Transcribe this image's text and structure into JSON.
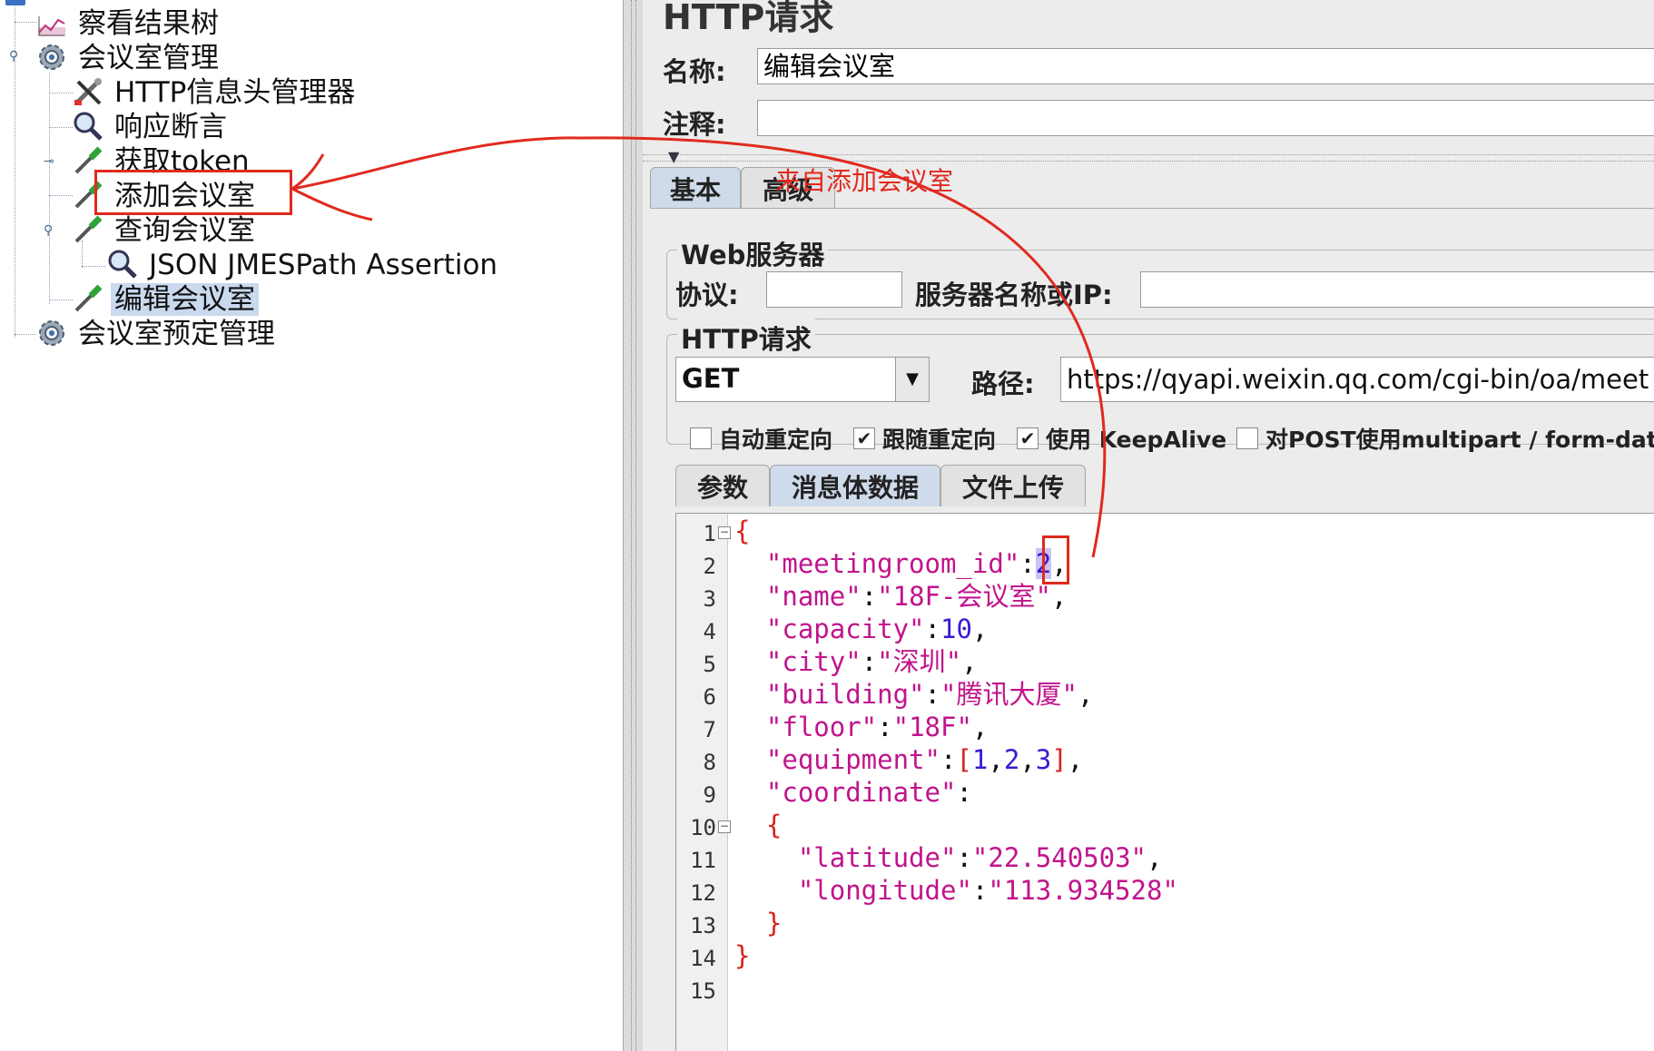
{
  "tree": {
    "items": [
      {
        "label": "察看结果树",
        "icon": "result-tree-icon"
      },
      {
        "label": "会议室管理",
        "icon": "gear-icon"
      },
      {
        "label": "HTTP信息头管理器",
        "icon": "wrench-icon"
      },
      {
        "label": "响应断言",
        "icon": "magnifier-icon"
      },
      {
        "label": "获取token",
        "icon": "pipette-icon"
      },
      {
        "label": "添加会议室",
        "icon": "pipette-icon"
      },
      {
        "label": "查询会议室",
        "icon": "pipette-icon"
      },
      {
        "label": "JSON JMESPath Assertion",
        "icon": "magnifier-icon"
      },
      {
        "label": "编辑会议室",
        "icon": "pipette-icon"
      },
      {
        "label": "会议室预定管理",
        "icon": "gear-icon"
      }
    ],
    "selected": "编辑会议室"
  },
  "panel": {
    "title": "HTTP请求",
    "name_label": "名称:",
    "name_value": "编辑会议室",
    "comment_label": "注释:",
    "comment_value": ""
  },
  "tabs": {
    "basic": "基本",
    "advanced": "高级"
  },
  "annotation": {
    "text": "来自添加会议室",
    "color": "#e02a1f"
  },
  "web_server": {
    "group_title": "Web服务器",
    "protocol_label": "协议:",
    "protocol_value": "",
    "server_label": "服务器名称或IP:",
    "server_value": ""
  },
  "http_request": {
    "group_title": "HTTP请求",
    "method": "GET",
    "path_label": "路径:",
    "path_value": "https://qyapi.weixin.qq.com/cgi-bin/oa/meet"
  },
  "options": [
    {
      "label": "自动重定向",
      "checked": false
    },
    {
      "label": "跟随重定向",
      "checked": true
    },
    {
      "label": "使用 KeepAlive",
      "checked": true
    },
    {
      "label": "对POST使用multipart / form-data",
      "checked": false
    }
  ],
  "body_tabs": [
    "参数",
    "消息体数据",
    "文件上传"
  ],
  "body_active_tab": "消息体数据",
  "body_lines": [
    "1",
    "2",
    "3",
    "4",
    "5",
    "6",
    "7",
    "8",
    "9",
    "10",
    "11",
    "12",
    "13",
    "14",
    "15"
  ],
  "body_json": {
    "meetingroom_id": "2",
    "name": "18F-会议室",
    "capacity": "10",
    "city": "深圳",
    "building": "腾讯大厦",
    "floor": "18F",
    "equipment": [
      "1",
      "2",
      "3"
    ],
    "latitude": "22.540503",
    "longitude": "113.934528"
  },
  "colors": {
    "highlight_box": "#e02a1f",
    "key": "#c0148c",
    "number": "#3b1ad3",
    "brace": "#d9231c"
  }
}
